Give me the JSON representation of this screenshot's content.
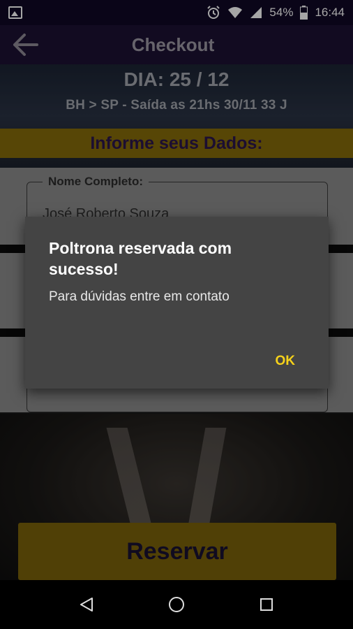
{
  "status_bar": {
    "battery": "54%",
    "time": "16:44",
    "icons": [
      "photo-icon",
      "alarm-icon",
      "wifi-icon",
      "signal-icon",
      "battery-icon"
    ]
  },
  "app_bar": {
    "title": "Checkout",
    "back_icon": "arrow-left-icon"
  },
  "trip": {
    "dia": "DIA: 25 / 12",
    "route": "BH > SP - Saída as 21hs 30/11 33 J"
  },
  "form": {
    "section_title": "Informe seus Dados:",
    "name_label": "Nome Completo:",
    "name_value": "José Roberto Souza"
  },
  "dialog": {
    "title": "Poltrona reservada com sucesso!",
    "message": "Para dúvidas entre em contato",
    "ok_label": "OK"
  },
  "reserve_button": {
    "label": "Reservar"
  },
  "nav_bar": {
    "icons": [
      "back-triangle-icon",
      "home-circle-icon",
      "recents-square-icon"
    ]
  },
  "colors": {
    "accent_yellow": "#866c0a",
    "dialog_ok": "#f6d21a",
    "title_purple": "#2c164c"
  }
}
